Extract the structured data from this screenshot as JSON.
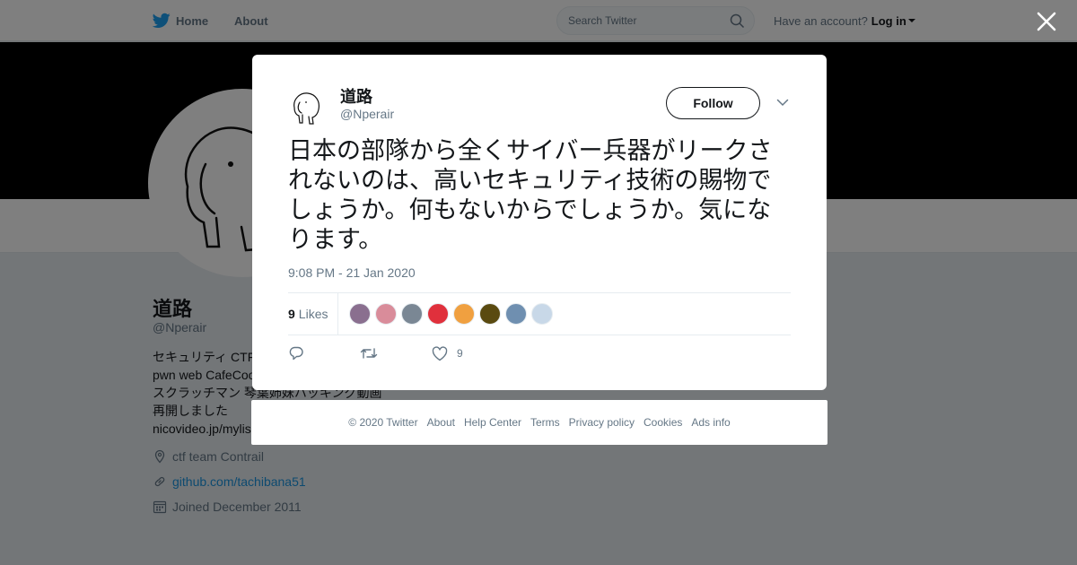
{
  "topbar": {
    "home_label": "Home",
    "about_label": "About",
    "search_placeholder": "Search Twitter",
    "have_account": "Have an account?",
    "login_label": "Log in"
  },
  "profile": {
    "name": "道路",
    "handle": "@Nperair",
    "bio_lines": [
      "セキュリティ CTF",
      "pwn web CafeCoo",
      "スクラッチマン 琴葉姉妹ハッキング動画",
      "再開しました",
      "nicovideo.jp/mylis"
    ],
    "location": "ctf team Contrail",
    "website": "github.com/tachibana51",
    "joined": "Joined December 2011"
  },
  "tweet": {
    "author_name": "道路",
    "author_handle": "@Nperair",
    "follow_label": "Follow",
    "text": "日本の部隊から全くサイバー兵器がリークされないのは、高いセキュリティ技術の賜物でしょうか。何もないからでしょうか。気になります。",
    "timestamp": "9:08 PM - 21 Jan 2020",
    "likes_count": "9",
    "likes_label": "Likes",
    "like_action_count": "9",
    "liker_colors": [
      "#8a6f8f",
      "#d98c9a",
      "#7a8794",
      "#e0303c",
      "#f0a040",
      "#5a4a10",
      "#6f8fb0",
      "#c8d8e8"
    ]
  },
  "footer": {
    "links": [
      "© 2020 Twitter",
      "About",
      "Help Center",
      "Terms",
      "Privacy policy",
      "Cookies",
      "Ads info"
    ]
  },
  "colors": {
    "twitter_blue": "#1da1f2",
    "text_secondary": "#657786"
  }
}
